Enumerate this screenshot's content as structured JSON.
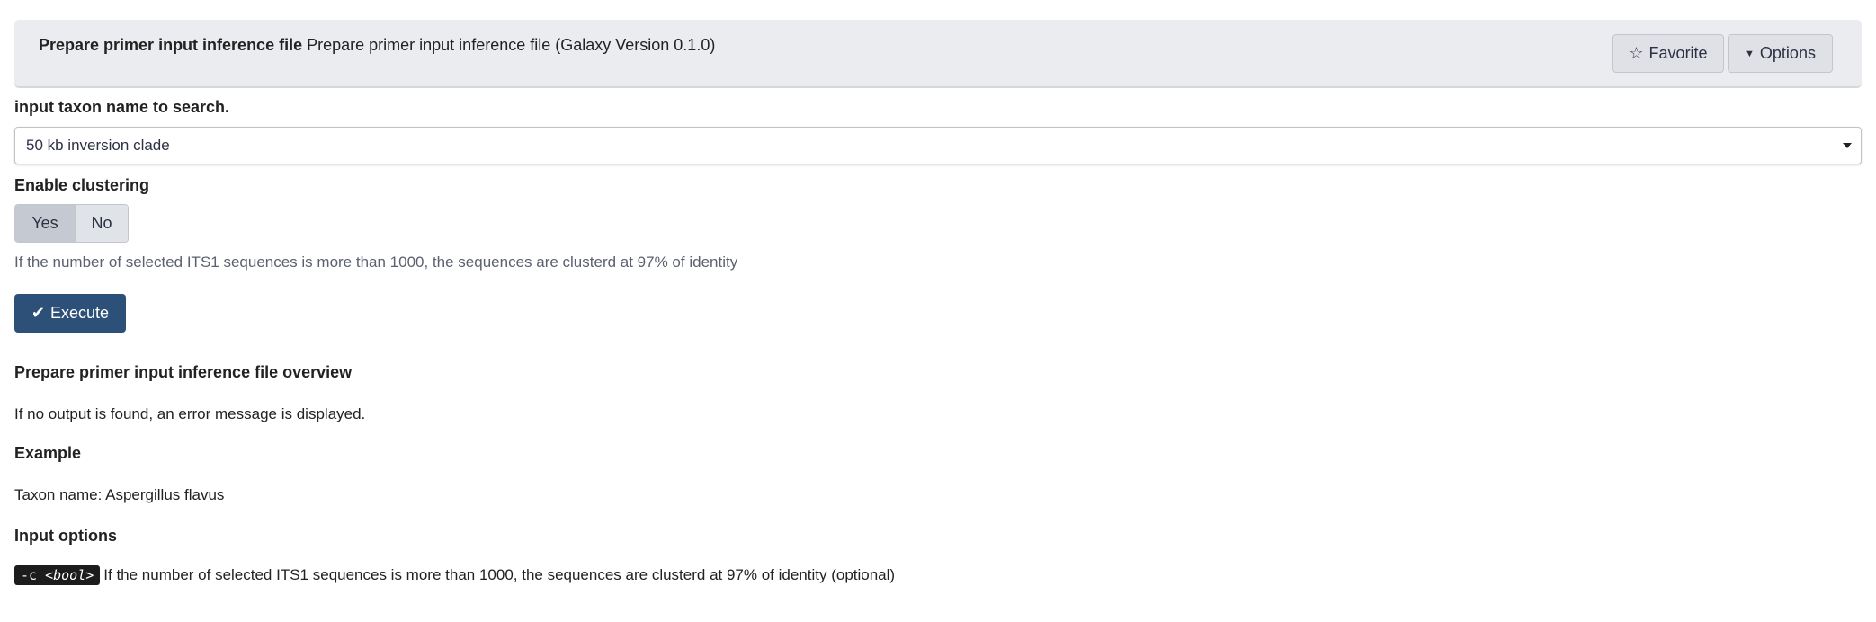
{
  "header": {
    "tool_name": "Prepare primer input inference file",
    "tool_description": "Prepare primer input inference file (Galaxy Version 0.1.0)",
    "favorite_label": "Favorite",
    "options_label": "Options"
  },
  "form": {
    "taxon_label": "input taxon name to search.",
    "taxon_value": "50 kb inversion clade",
    "clustering_label": "Enable clustering",
    "clustering_yes": "Yes",
    "clustering_no": "No",
    "clustering_selected": "Yes",
    "clustering_help": "If the number of selected ITS1 sequences is more than 1000, the sequences are clusterd at 97% of identity",
    "execute_label": "Execute"
  },
  "help": {
    "overview_heading": "Prepare primer input inference file overview",
    "overview_text": "If no output is found, an error message is displayed.",
    "example_heading": "Example",
    "example_text": "Taxon name: Aspergillus flavus",
    "options_heading": "Input options",
    "option_flag": "-c",
    "option_type": "<bool>",
    "option_text": "If the number of selected ITS1 sequences is more than 1000, the sequences are clusterd at 97% of identity (optional)"
  }
}
